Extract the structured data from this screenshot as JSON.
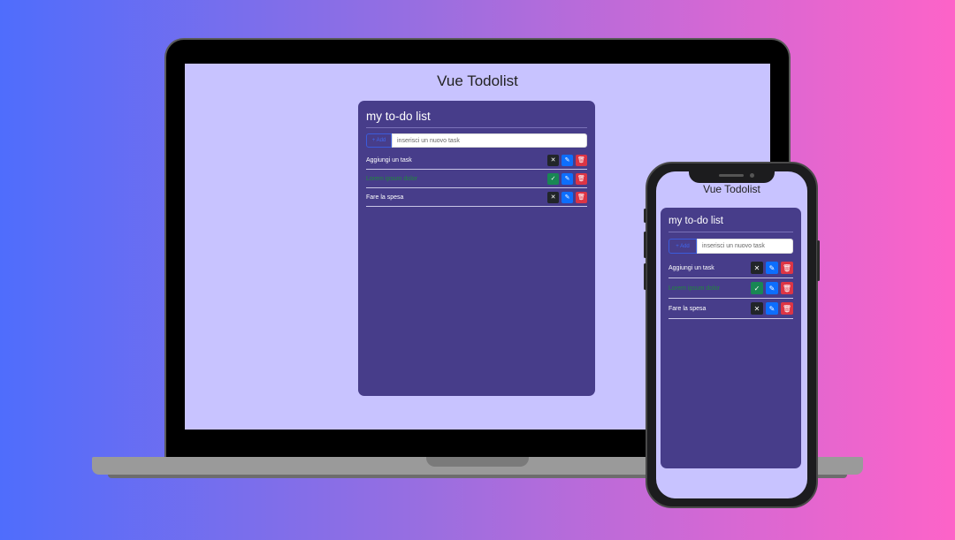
{
  "app": {
    "title": "Vue Todolist",
    "list_title": "my to-do list",
    "add_label": "+ Add",
    "input_placeholder": "inserisci un nuovo task"
  },
  "tasks": [
    {
      "text": "Aggiungi un task",
      "done": false
    },
    {
      "text": "Lorem ipsum dolor",
      "done": true
    },
    {
      "text": "Fare la spesa",
      "done": false
    }
  ],
  "icons": {
    "not_done": "x-icon",
    "done": "check-icon",
    "edit": "edit-icon",
    "delete": "trash-icon"
  },
  "colors": {
    "background_start": "#4f6dfc",
    "background_end": "#fd63c8",
    "screen_bg": "#c8c3ff",
    "card_bg": "#473d8a",
    "done_text": "#1f8a3c",
    "btn_dark": "#212529",
    "btn_green": "#198754",
    "btn_edit": "#0d6efd",
    "btn_delete": "#dc3545"
  }
}
